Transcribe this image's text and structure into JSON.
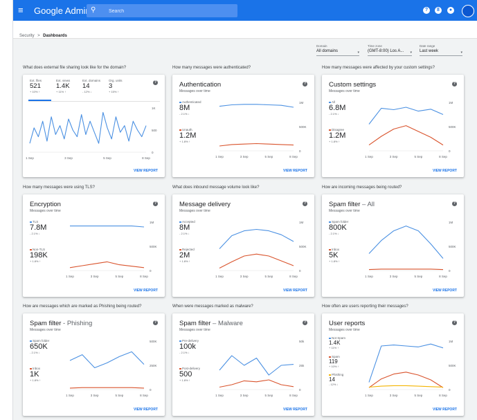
{
  "app": {
    "brand": "Google Admin",
    "search_placeholder": "Search"
  },
  "breadcrumb": {
    "parent": "Security",
    "sep": ">",
    "current": "Dashboards"
  },
  "filters": [
    {
      "label": "Domain",
      "value": "All domains"
    },
    {
      "label": "Time zone",
      "value": "(GMT-8:00) Los A..."
    },
    {
      "label": "Date range",
      "value": "Last week"
    }
  ],
  "colors": {
    "blue": "#4a90e2",
    "red": "#d9532c",
    "yellow": "#f4b400",
    "accent": "#1a73e8"
  },
  "x_ticks": [
    "1 Sep",
    "3 Sep",
    "5 Sep",
    "8 Sep"
  ],
  "view_report": "VIEW REPORT",
  "cards": [
    {
      "question": "What does external file sharing look like for the domain?",
      "tabs": [
        {
          "label": "Ext. files",
          "value": "521",
          "delta": "+ 10% ↑"
        },
        {
          "label": "Ext. views",
          "value": "1.4K",
          "delta": "+ 11% ↑"
        },
        {
          "label": "Ext. domains",
          "value": "14",
          "delta": "- 12% ↓"
        },
        {
          "label": "Org. units",
          "value": "3",
          "delta": "+ 15% ↑"
        }
      ],
      "y_ticks": [
        "1K",
        "500",
        "0"
      ]
    },
    {
      "question": "How many messages were authenticated?",
      "title": "Authentication",
      "subtitle": "Messages over time",
      "metrics": [
        {
          "label": "Authenticated",
          "value": "8M",
          "delta": "- 2.1% ↓",
          "color": "#4a90e2"
        },
        {
          "label": "Unauth.",
          "value": "1.2M",
          "delta": "+ 1.8% ↑",
          "color": "#d9532c"
        }
      ],
      "y_ticks": [
        "1M",
        "500K",
        "0"
      ]
    },
    {
      "question": "How many messages were affected by your custom settings?",
      "title": "Custom settings",
      "subtitle": "Messages over time",
      "metrics": [
        {
          "label": "All",
          "value": "6.8M",
          "delta": "- 2.1% ↓",
          "color": "#4a90e2"
        },
        {
          "label": "Disagree",
          "value": "1.2M",
          "delta": "+ 1.8% ↑",
          "color": "#d9532c"
        }
      ],
      "y_ticks": [
        "1M",
        "500K",
        "0"
      ]
    },
    {
      "question": "How many messages were using TLS?",
      "title": "Encryption",
      "subtitle": "Messages over time",
      "metrics": [
        {
          "label": "TLS",
          "value": "7.8M",
          "delta": "- 2.1% ↓",
          "color": "#4a90e2"
        },
        {
          "label": "Non-TLS",
          "value": "198K",
          "delta": "+ 1.8% ↑",
          "color": "#d9532c"
        }
      ],
      "y_ticks": [
        "1M",
        "500K",
        "0"
      ]
    },
    {
      "question": "What does inbound message volume look like?",
      "title": "Message delivery",
      "subtitle": "Messages over time",
      "metrics": [
        {
          "label": "Accepted",
          "value": "8M",
          "delta": "- 2.1% ↓",
          "color": "#4a90e2"
        },
        {
          "label": "Rejected",
          "value": "2M",
          "delta": "+ 1.8% ↑",
          "color": "#d9532c"
        }
      ],
      "y_ticks": [
        "1M",
        "500K",
        "0"
      ]
    },
    {
      "question": "How are incoming messages being routed?",
      "title": "Spam filter",
      "title_suffix": " – All",
      "subtitle": "Messages over time",
      "metrics": [
        {
          "label": "Spam folder",
          "value": "800K",
          "delta": "- 2.1% ↓",
          "color": "#4a90e2"
        },
        {
          "label": "Inbox",
          "value": "5K",
          "delta": "+ 1.8% ↑",
          "color": "#d9532c"
        }
      ],
      "y_ticks": [
        "1M",
        "500K",
        "0"
      ]
    },
    {
      "question": "How are messages which are marked as Phishing being routed?",
      "title": "Spam filter",
      "title_suffix": " - Phishing",
      "subtitle": "Messages over time",
      "metrics": [
        {
          "label": "Spam folder",
          "value": "650K",
          "delta": "- 2.1% ↓",
          "color": "#4a90e2"
        },
        {
          "label": "Inbox",
          "value": "1K",
          "delta": "+ 1.8% ↑",
          "color": "#d9532c"
        }
      ],
      "y_ticks": [
        "500K",
        "250K",
        "0"
      ]
    },
    {
      "question": "When were messages marked as malware?",
      "title": "Spam filter",
      "title_suffix": " – Malware",
      "subtitle": "Messages over time",
      "metrics": [
        {
          "label": "Pre-delivery",
          "value": "100k",
          "delta": "- 2.1% ↓",
          "color": "#4a90e2"
        },
        {
          "label": "Post-delivery",
          "value": "500",
          "delta": "+ 1.8% ↑",
          "color": "#d9532c"
        }
      ],
      "y_ticks": [
        "50k",
        "25k",
        "0"
      ]
    },
    {
      "question": "How often are users reporting their messages?",
      "title": "User reports",
      "subtitle": "Messages over time",
      "metrics": [
        {
          "label": "Not Spam",
          "value": "1.4K",
          "delta": "+ 11% ↑",
          "color": "#4a90e2"
        },
        {
          "label": "Spam",
          "value": "119",
          "delta": "+ 10% ↑",
          "color": "#d9532c"
        },
        {
          "label": "Phishing",
          "value": "14",
          "delta": "- 12% ↓",
          "color": "#f4b400"
        }
      ],
      "y_ticks": [
        "1M",
        "500K",
        "0"
      ]
    }
  ]
}
